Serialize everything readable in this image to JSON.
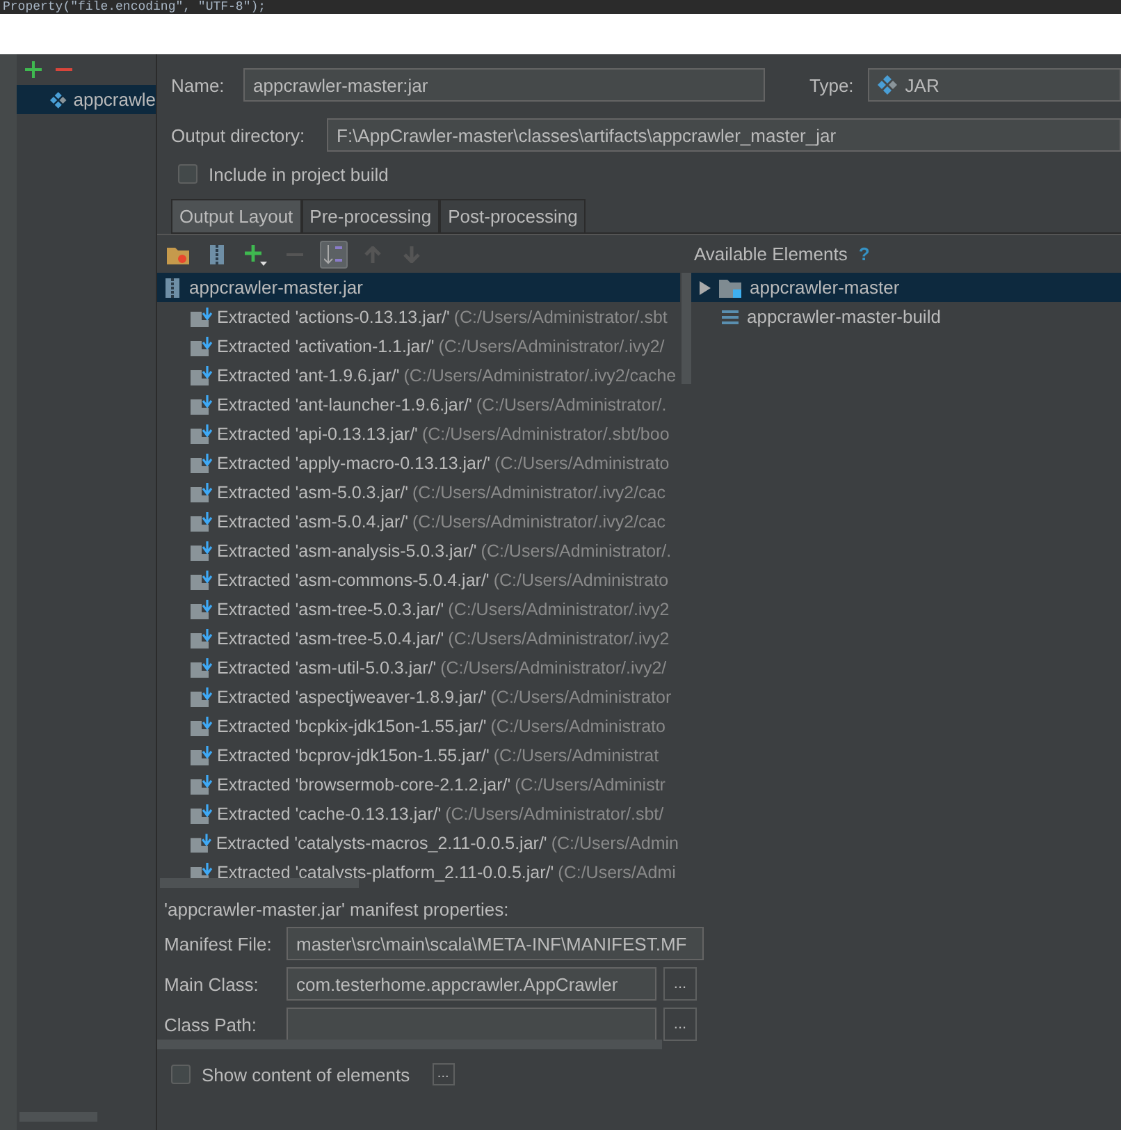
{
  "code_line": "Property(\"file.encoding\", \"UTF-8\");",
  "sidebar": {
    "items": [
      {
        "label": "appcrawle",
        "selected": true
      }
    ]
  },
  "name_field": {
    "label": "Name:",
    "value": "appcrawler-master:jar"
  },
  "type_field": {
    "label": "Type:",
    "value": "JAR"
  },
  "output_directory": {
    "label": "Output directory:",
    "value": "F:\\AppCrawler-master\\classes\\artifacts\\appcrawler_master_jar"
  },
  "include_in_build": {
    "label": "Include in project build",
    "checked": false
  },
  "tabs": [
    {
      "label": "Output Layout",
      "selected": true
    },
    {
      "label": "Pre-processing",
      "selected": false
    },
    {
      "label": "Post-processing",
      "selected": false
    }
  ],
  "layout_tree": {
    "root": {
      "label": "appcrawler-master.jar",
      "selected": true
    },
    "children": [
      {
        "name": "Extracted 'actions-0.13.13.jar/'",
        "path": "(C:/Users/Administrator/.sbt"
      },
      {
        "name": "Extracted 'activation-1.1.jar/'",
        "path": "(C:/Users/Administrator/.ivy2/"
      },
      {
        "name": "Extracted 'ant-1.9.6.jar/'",
        "path": "(C:/Users/Administrator/.ivy2/cache"
      },
      {
        "name": "Extracted 'ant-launcher-1.9.6.jar/'",
        "path": "(C:/Users/Administrator/."
      },
      {
        "name": "Extracted 'api-0.13.13.jar/'",
        "path": "(C:/Users/Administrator/.sbt/boo"
      },
      {
        "name": "Extracted 'apply-macro-0.13.13.jar/'",
        "path": "(C:/Users/Administrato"
      },
      {
        "name": "Extracted 'asm-5.0.3.jar/'",
        "path": "(C:/Users/Administrator/.ivy2/cac"
      },
      {
        "name": "Extracted 'asm-5.0.4.jar/'",
        "path": "(C:/Users/Administrator/.ivy2/cac"
      },
      {
        "name": "Extracted 'asm-analysis-5.0.3.jar/'",
        "path": "(C:/Users/Administrator/."
      },
      {
        "name": "Extracted 'asm-commons-5.0.4.jar/'",
        "path": "(C:/Users/Administrato"
      },
      {
        "name": "Extracted 'asm-tree-5.0.3.jar/'",
        "path": "(C:/Users/Administrator/.ivy2"
      },
      {
        "name": "Extracted 'asm-tree-5.0.4.jar/'",
        "path": "(C:/Users/Administrator/.ivy2"
      },
      {
        "name": "Extracted 'asm-util-5.0.3.jar/'",
        "path": "(C:/Users/Administrator/.ivy2/"
      },
      {
        "name": "Extracted 'aspectjweaver-1.8.9.jar/'",
        "path": "(C:/Users/Administrator"
      },
      {
        "name": "Extracted 'bcpkix-jdk15on-1.55.jar/'",
        "path": "(C:/Users/Administrato"
      },
      {
        "name": "Extracted 'bcprov-jdk15on-1.55.jar/'",
        "path": "(C:/Users/Administrat"
      },
      {
        "name": "Extracted 'browsermob-core-2.1.2.jar/'",
        "path": "(C:/Users/Administr"
      },
      {
        "name": "Extracted 'cache-0.13.13.jar/'",
        "path": "(C:/Users/Administrator/.sbt/"
      },
      {
        "name": "Extracted 'catalysts-macros_2.11-0.0.5.jar/'",
        "path": "(C:/Users/Admin"
      },
      {
        "name": "Extracted 'catalysts-platform_2.11-0.0.5.jar/'",
        "path": "(C:/Users/Admi"
      }
    ]
  },
  "available_elements": {
    "title": "Available Elements",
    "help": "?",
    "items": [
      {
        "kind": "module",
        "label": "appcrawler-master",
        "selected": true
      },
      {
        "kind": "library",
        "label": "appcrawler-master-build",
        "selected": false
      }
    ]
  },
  "manifest": {
    "title": "'appcrawler-master.jar' manifest properties:",
    "fields": [
      {
        "label": "Manifest File:",
        "value": "master\\src\\main\\scala\\META-INF\\MANIFEST.MF"
      },
      {
        "label": "Main Class:",
        "value": "com.testerhome.appcrawler.AppCrawler",
        "browse": "..."
      },
      {
        "label": "Class Path:",
        "browse": "..."
      }
    ]
  },
  "show_content": {
    "label": "Show content of elements",
    "checked": false,
    "button": "..."
  }
}
